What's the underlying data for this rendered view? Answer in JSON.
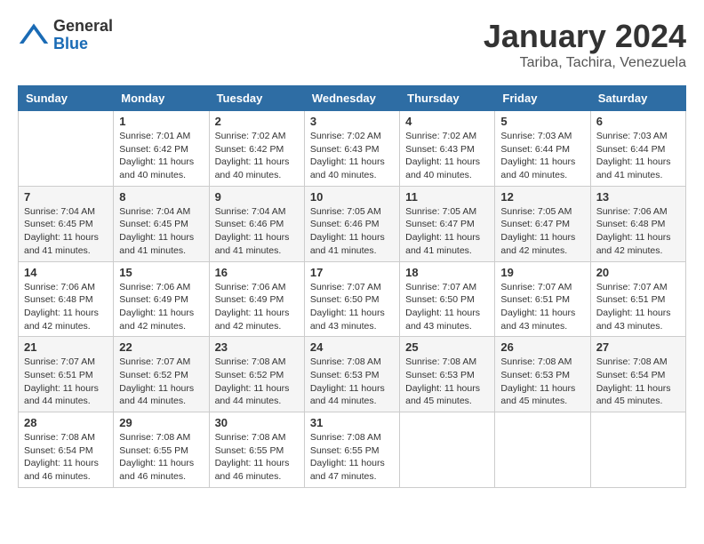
{
  "header": {
    "logo_general": "General",
    "logo_blue": "Blue",
    "month_title": "January 2024",
    "location": "Tariba, Tachira, Venezuela"
  },
  "days_of_week": [
    "Sunday",
    "Monday",
    "Tuesday",
    "Wednesday",
    "Thursday",
    "Friday",
    "Saturday"
  ],
  "weeks": [
    [
      {
        "day": "",
        "sunrise": "",
        "sunset": "",
        "daylight": ""
      },
      {
        "day": "1",
        "sunrise": "Sunrise: 7:01 AM",
        "sunset": "Sunset: 6:42 PM",
        "daylight": "Daylight: 11 hours and 40 minutes."
      },
      {
        "day": "2",
        "sunrise": "Sunrise: 7:02 AM",
        "sunset": "Sunset: 6:42 PM",
        "daylight": "Daylight: 11 hours and 40 minutes."
      },
      {
        "day": "3",
        "sunrise": "Sunrise: 7:02 AM",
        "sunset": "Sunset: 6:43 PM",
        "daylight": "Daylight: 11 hours and 40 minutes."
      },
      {
        "day": "4",
        "sunrise": "Sunrise: 7:02 AM",
        "sunset": "Sunset: 6:43 PM",
        "daylight": "Daylight: 11 hours and 40 minutes."
      },
      {
        "day": "5",
        "sunrise": "Sunrise: 7:03 AM",
        "sunset": "Sunset: 6:44 PM",
        "daylight": "Daylight: 11 hours and 40 minutes."
      },
      {
        "day": "6",
        "sunrise": "Sunrise: 7:03 AM",
        "sunset": "Sunset: 6:44 PM",
        "daylight": "Daylight: 11 hours and 41 minutes."
      }
    ],
    [
      {
        "day": "7",
        "sunrise": "Sunrise: 7:04 AM",
        "sunset": "Sunset: 6:45 PM",
        "daylight": "Daylight: 11 hours and 41 minutes."
      },
      {
        "day": "8",
        "sunrise": "Sunrise: 7:04 AM",
        "sunset": "Sunset: 6:45 PM",
        "daylight": "Daylight: 11 hours and 41 minutes."
      },
      {
        "day": "9",
        "sunrise": "Sunrise: 7:04 AM",
        "sunset": "Sunset: 6:46 PM",
        "daylight": "Daylight: 11 hours and 41 minutes."
      },
      {
        "day": "10",
        "sunrise": "Sunrise: 7:05 AM",
        "sunset": "Sunset: 6:46 PM",
        "daylight": "Daylight: 11 hours and 41 minutes."
      },
      {
        "day": "11",
        "sunrise": "Sunrise: 7:05 AM",
        "sunset": "Sunset: 6:47 PM",
        "daylight": "Daylight: 11 hours and 41 minutes."
      },
      {
        "day": "12",
        "sunrise": "Sunrise: 7:05 AM",
        "sunset": "Sunset: 6:47 PM",
        "daylight": "Daylight: 11 hours and 42 minutes."
      },
      {
        "day": "13",
        "sunrise": "Sunrise: 7:06 AM",
        "sunset": "Sunset: 6:48 PM",
        "daylight": "Daylight: 11 hours and 42 minutes."
      }
    ],
    [
      {
        "day": "14",
        "sunrise": "Sunrise: 7:06 AM",
        "sunset": "Sunset: 6:48 PM",
        "daylight": "Daylight: 11 hours and 42 minutes."
      },
      {
        "day": "15",
        "sunrise": "Sunrise: 7:06 AM",
        "sunset": "Sunset: 6:49 PM",
        "daylight": "Daylight: 11 hours and 42 minutes."
      },
      {
        "day": "16",
        "sunrise": "Sunrise: 7:06 AM",
        "sunset": "Sunset: 6:49 PM",
        "daylight": "Daylight: 11 hours and 42 minutes."
      },
      {
        "day": "17",
        "sunrise": "Sunrise: 7:07 AM",
        "sunset": "Sunset: 6:50 PM",
        "daylight": "Daylight: 11 hours and 43 minutes."
      },
      {
        "day": "18",
        "sunrise": "Sunrise: 7:07 AM",
        "sunset": "Sunset: 6:50 PM",
        "daylight": "Daylight: 11 hours and 43 minutes."
      },
      {
        "day": "19",
        "sunrise": "Sunrise: 7:07 AM",
        "sunset": "Sunset: 6:51 PM",
        "daylight": "Daylight: 11 hours and 43 minutes."
      },
      {
        "day": "20",
        "sunrise": "Sunrise: 7:07 AM",
        "sunset": "Sunset: 6:51 PM",
        "daylight": "Daylight: 11 hours and 43 minutes."
      }
    ],
    [
      {
        "day": "21",
        "sunrise": "Sunrise: 7:07 AM",
        "sunset": "Sunset: 6:51 PM",
        "daylight": "Daylight: 11 hours and 44 minutes."
      },
      {
        "day": "22",
        "sunrise": "Sunrise: 7:07 AM",
        "sunset": "Sunset: 6:52 PM",
        "daylight": "Daylight: 11 hours and 44 minutes."
      },
      {
        "day": "23",
        "sunrise": "Sunrise: 7:08 AM",
        "sunset": "Sunset: 6:52 PM",
        "daylight": "Daylight: 11 hours and 44 minutes."
      },
      {
        "day": "24",
        "sunrise": "Sunrise: 7:08 AM",
        "sunset": "Sunset: 6:53 PM",
        "daylight": "Daylight: 11 hours and 44 minutes."
      },
      {
        "day": "25",
        "sunrise": "Sunrise: 7:08 AM",
        "sunset": "Sunset: 6:53 PM",
        "daylight": "Daylight: 11 hours and 45 minutes."
      },
      {
        "day": "26",
        "sunrise": "Sunrise: 7:08 AM",
        "sunset": "Sunset: 6:53 PM",
        "daylight": "Daylight: 11 hours and 45 minutes."
      },
      {
        "day": "27",
        "sunrise": "Sunrise: 7:08 AM",
        "sunset": "Sunset: 6:54 PM",
        "daylight": "Daylight: 11 hours and 45 minutes."
      }
    ],
    [
      {
        "day": "28",
        "sunrise": "Sunrise: 7:08 AM",
        "sunset": "Sunset: 6:54 PM",
        "daylight": "Daylight: 11 hours and 46 minutes."
      },
      {
        "day": "29",
        "sunrise": "Sunrise: 7:08 AM",
        "sunset": "Sunset: 6:55 PM",
        "daylight": "Daylight: 11 hours and 46 minutes."
      },
      {
        "day": "30",
        "sunrise": "Sunrise: 7:08 AM",
        "sunset": "Sunset: 6:55 PM",
        "daylight": "Daylight: 11 hours and 46 minutes."
      },
      {
        "day": "31",
        "sunrise": "Sunrise: 7:08 AM",
        "sunset": "Sunset: 6:55 PM",
        "daylight": "Daylight: 11 hours and 47 minutes."
      },
      {
        "day": "",
        "sunrise": "",
        "sunset": "",
        "daylight": ""
      },
      {
        "day": "",
        "sunrise": "",
        "sunset": "",
        "daylight": ""
      },
      {
        "day": "",
        "sunrise": "",
        "sunset": "",
        "daylight": ""
      }
    ]
  ]
}
